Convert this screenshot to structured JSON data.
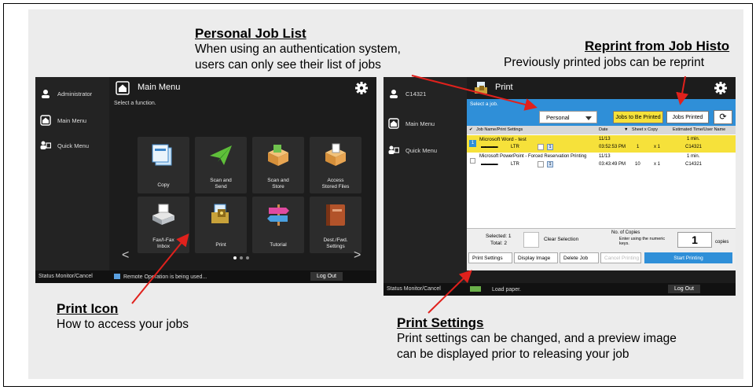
{
  "callouts": {
    "personal_job_list": {
      "title": "Personal Job List",
      "line1": "When using an authentication system,",
      "line2": "users can only see their list of jobs"
    },
    "reprint": {
      "title": "Reprint from Job Histo",
      "line1": "Previously printed jobs can be reprint"
    },
    "print_icon": {
      "title": "Print Icon",
      "line1": "How to access your jobs"
    },
    "print_settings": {
      "title": "Print Settings",
      "line1": "Print settings can be changed, and a preview image",
      "line2": "can be displayed prior to releasing your job"
    }
  },
  "left_screen": {
    "user": "Administrator",
    "side": [
      "Main Menu",
      "Quick Menu"
    ],
    "title": "Main Menu",
    "subtitle": "Select a function.",
    "tiles": [
      {
        "label1": "Copy",
        "label2": ""
      },
      {
        "label1": "Scan and",
        "label2": "Send"
      },
      {
        "label1": "Scan and",
        "label2": "Store"
      },
      {
        "label1": "Access",
        "label2": "Stored Files"
      },
      {
        "label1": "Fax/I-Fax",
        "label2": "Inbox"
      },
      {
        "label1": "Print",
        "label2": ""
      },
      {
        "label1": "Tutorial",
        "label2": ""
      },
      {
        "label1": "Dest./Fwd.",
        "label2": "Settings"
      }
    ],
    "prev": "<",
    "next": ">",
    "status": "Status Monitor/Cancel",
    "remote": "Remote Operation is being used...",
    "logout": "Log Out"
  },
  "right_screen": {
    "user": "C14321",
    "side": [
      "Main Menu",
      "Quick Menu"
    ],
    "title": "Print",
    "select_job": "Select a job.",
    "dropdown": "Personal",
    "tab_to_print": "Jobs to Be Printed",
    "tab_printed": "Jobs Printed",
    "columns": {
      "name": "Job Name/Print Settings",
      "date": "Date",
      "sheets": "Sheet x Copy",
      "est": "Estimated Time/User Name"
    },
    "jobs": [
      {
        "num": "1",
        "name": "Microsoft Word - test",
        "paper": "LTR",
        "icon": "1",
        "date": "11/13",
        "time": "03:52:53 PM",
        "sheets": "1",
        "copies": "x 1",
        "est": "1 min.",
        "user": "C14321"
      },
      {
        "num": "",
        "name": "Microsoft PowerPoint - Forced Reservation Printing",
        "paper": "LTR",
        "icon": "1",
        "date": "11/13",
        "time": "03:43:49 PM",
        "sheets": "10",
        "copies": "x 1",
        "est": "1 min.",
        "user": "C14321"
      }
    ],
    "selected": "Selected: 1",
    "total": "Total: 2",
    "clear": "Clear Selection",
    "copies_label": "No. of Copies",
    "copies_hint1": "Enter using the numeric",
    "copies_hint2": "keys.",
    "copies_value": "1",
    "copies_unit": "copies",
    "btn_settings": "Print Settings",
    "btn_display": "Display Image",
    "btn_delete": "Delete Job",
    "btn_cancel": "Cancel Printing",
    "btn_start": "Start Printing",
    "status": "Status Monitor/Cancel",
    "load_paper": "Load paper.",
    "logout": "Log Out"
  },
  "colors": {
    "accent_blue": "#2f8fd8",
    "highlight_yellow": "#f6e13a",
    "arrow_red": "#e0211c"
  }
}
